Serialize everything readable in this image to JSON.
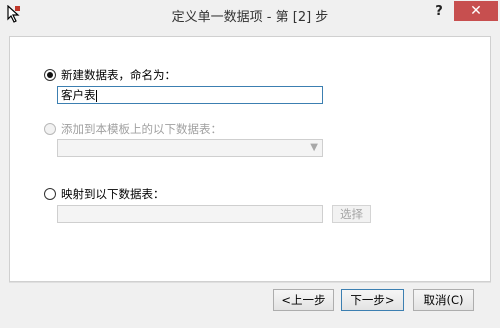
{
  "window": {
    "title": "定义单一数据项 - 第 [2] 步",
    "help_label": "?",
    "close_label": "✕",
    "icon": "cursor-app-icon"
  },
  "options": {
    "new_table": {
      "label": "新建数据表，命名为：",
      "value": "客户表",
      "selected": true
    },
    "add_to_template": {
      "label": "添加到本模板上的以下数据表：",
      "selected_value": "",
      "disabled": true
    },
    "map_to_table": {
      "label": "映射到以下数据表：",
      "value": "",
      "select_button": "选择",
      "selected": false
    }
  },
  "footer": {
    "prev_label": "<上一步",
    "next_label": "下一步>",
    "cancel_label": "取消(C)"
  },
  "colors": {
    "close_button": "#c74f4f",
    "focus_border": "#3c7fb1",
    "dialog_background": "#f0f0f0"
  }
}
